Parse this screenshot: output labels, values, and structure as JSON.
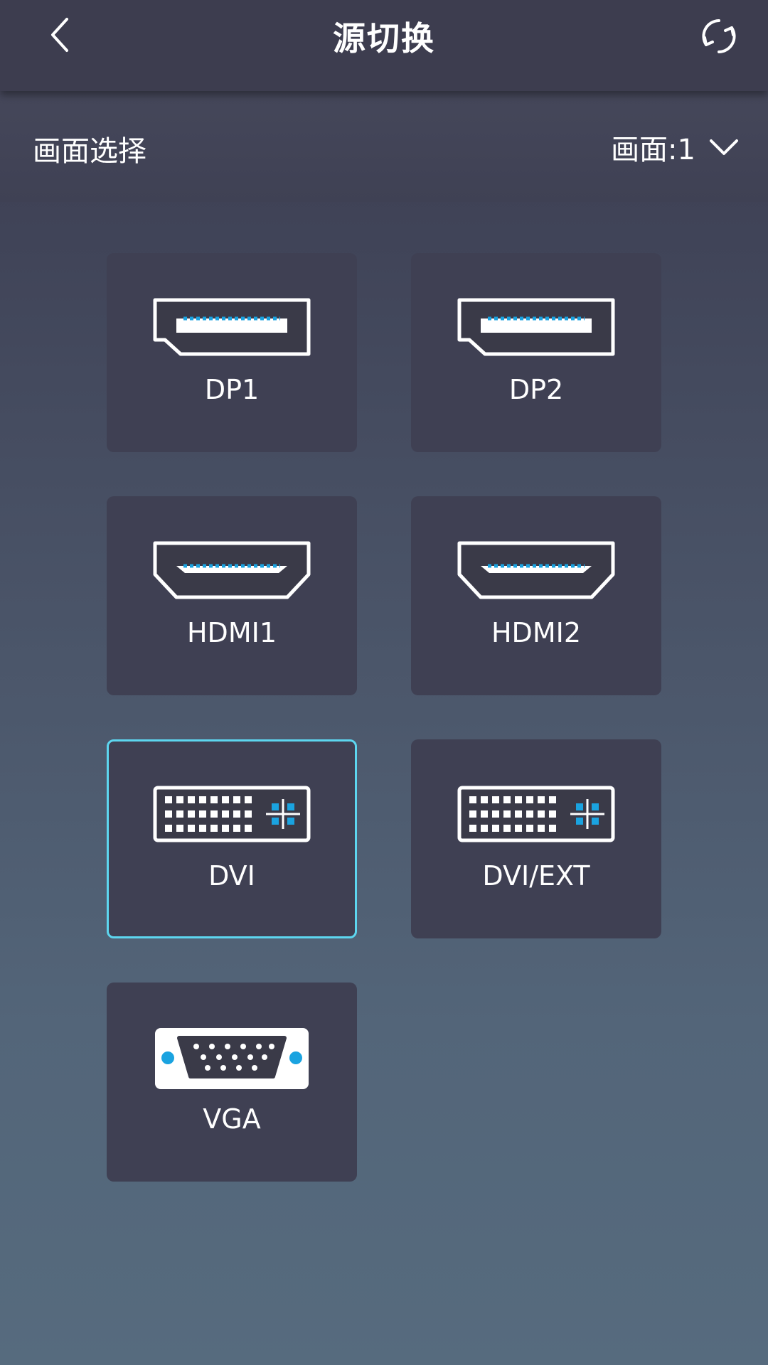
{
  "header": {
    "title": "源切换",
    "back_icon": "chevron-left-icon",
    "refresh_icon": "refresh-icon"
  },
  "selector": {
    "label": "画面选择",
    "value": "画面:1",
    "dropdown_icon": "chevron-down-icon"
  },
  "sources": [
    {
      "label": "DP1",
      "type": "displayport",
      "selected": false
    },
    {
      "label": "DP2",
      "type": "displayport",
      "selected": false
    },
    {
      "label": "HDMI1",
      "type": "hdmi",
      "selected": false
    },
    {
      "label": "HDMI2",
      "type": "hdmi",
      "selected": false
    },
    {
      "label": "DVI",
      "type": "dvi",
      "selected": true
    },
    {
      "label": "DVI/EXT",
      "type": "dvi",
      "selected": false
    },
    {
      "label": "VGA",
      "type": "vga",
      "selected": false
    }
  ],
  "colors": {
    "accent": "#5dd6ef",
    "pin_blue": "#1aa3e0",
    "tile_bg": "#3f4053",
    "header_bg": "#3d3d4f"
  }
}
